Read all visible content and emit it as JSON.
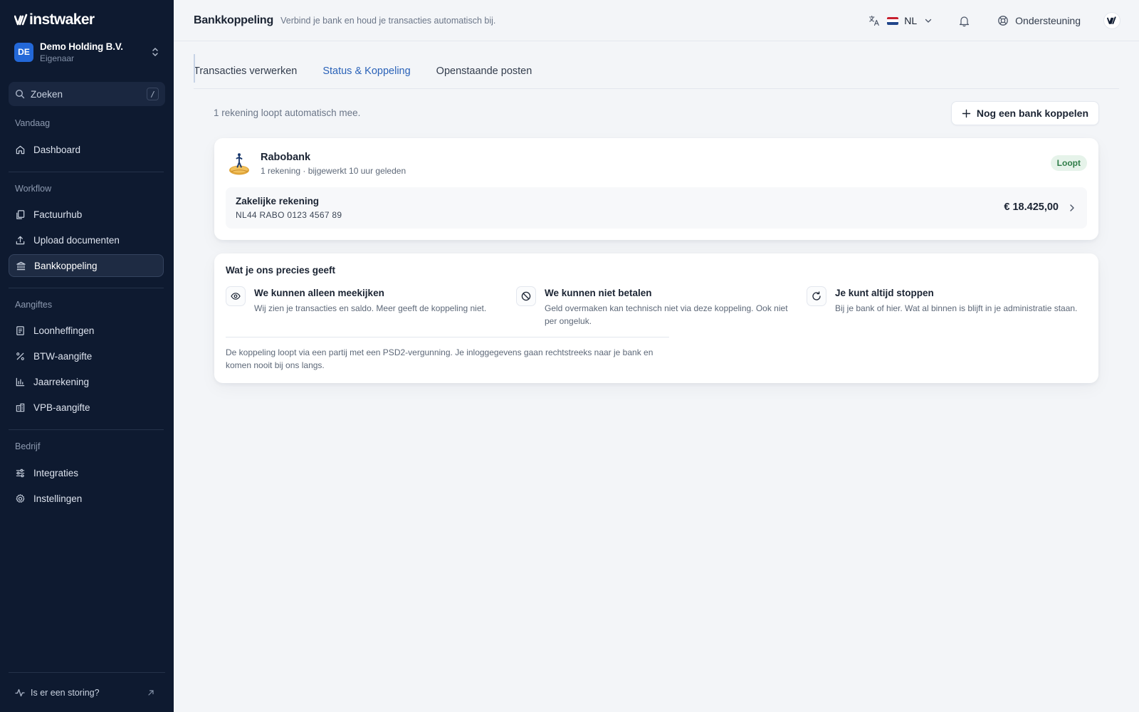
{
  "brand": {
    "logo_text": "instwaker"
  },
  "org": {
    "initials": "DE",
    "name": "Demo Holding B.V.",
    "role": "Eigenaar"
  },
  "search": {
    "placeholder": "Zoeken",
    "shortcut": "/"
  },
  "sidebar": {
    "sections": [
      {
        "label": "Vandaag",
        "items": [
          {
            "label": "Dashboard",
            "icon": "home-icon"
          }
        ]
      },
      {
        "label": "Workflow",
        "items": [
          {
            "label": "Factuurhub",
            "icon": "files-icon"
          },
          {
            "label": "Upload documenten",
            "icon": "upload-icon"
          },
          {
            "label": "Bankkoppeling",
            "icon": "bank-icon",
            "active": true
          }
        ]
      },
      {
        "label": "Aangiftes",
        "items": [
          {
            "label": "Loonheffingen",
            "icon": "list-doc-icon"
          },
          {
            "label": "BTW-aangifte",
            "icon": "percent-icon"
          },
          {
            "label": "Jaarrekening",
            "icon": "bar-chart-icon"
          },
          {
            "label": "VPB-aangifte",
            "icon": "building-icon"
          }
        ]
      },
      {
        "label": "Bedrijf",
        "items": [
          {
            "label": "Integraties",
            "icon": "sliders-icon"
          },
          {
            "label": "Instellingen",
            "icon": "gear-icon"
          }
        ]
      }
    ],
    "footer_label": "Is er een storing?"
  },
  "header": {
    "title": "Bankkoppeling",
    "subtitle": "Verbind je bank en houd je transacties automatisch bij.",
    "language": "NL",
    "support_label": "Ondersteuning"
  },
  "tabs": [
    {
      "label": "Transacties verwerken",
      "active": false
    },
    {
      "label": "Status & Koppeling",
      "active": true
    },
    {
      "label": "Openstaande posten",
      "active": false
    }
  ],
  "main": {
    "count_text": "1 rekening loopt automatisch mee.",
    "add_bank_label": "Nog een bank koppelen",
    "bank": {
      "name": "Rabobank",
      "meta": "1 rekening · bijgewerkt 10 uur geleden",
      "status": "Loopt",
      "account": {
        "name": "Zakelijke rekening",
        "iban": "NL44 RABO 0123 4567 89",
        "balance": "€ 18.425,00"
      }
    },
    "info": {
      "title": "Wat je ons precies geeft",
      "features": [
        {
          "title": "We kunnen alleen meekijken",
          "desc": "Wij zien je transacties en saldo. Meer geeft de koppeling niet.",
          "icon": "eye-icon"
        },
        {
          "title": "We kunnen niet betalen",
          "desc": "Geld overmaken kan technisch niet via deze koppeling. Ook niet per ongeluk.",
          "icon": "ban-icon"
        },
        {
          "title": "Je kunt altijd stoppen",
          "desc": "Bij je bank of hier. Wat al binnen is blijft in je administratie staan.",
          "icon": "refresh-icon"
        }
      ],
      "note": "De koppeling loopt via een partij met een PSD2-vergunning. Je inloggegevens gaan rechtstreeks naar je bank en komen nooit bij ons langs."
    }
  },
  "colors": {
    "sidebar_bg": "#0e1a30",
    "accent": "#2a62b8",
    "status_green": "#2f7d48",
    "avatar_blue": "#2368d8"
  }
}
